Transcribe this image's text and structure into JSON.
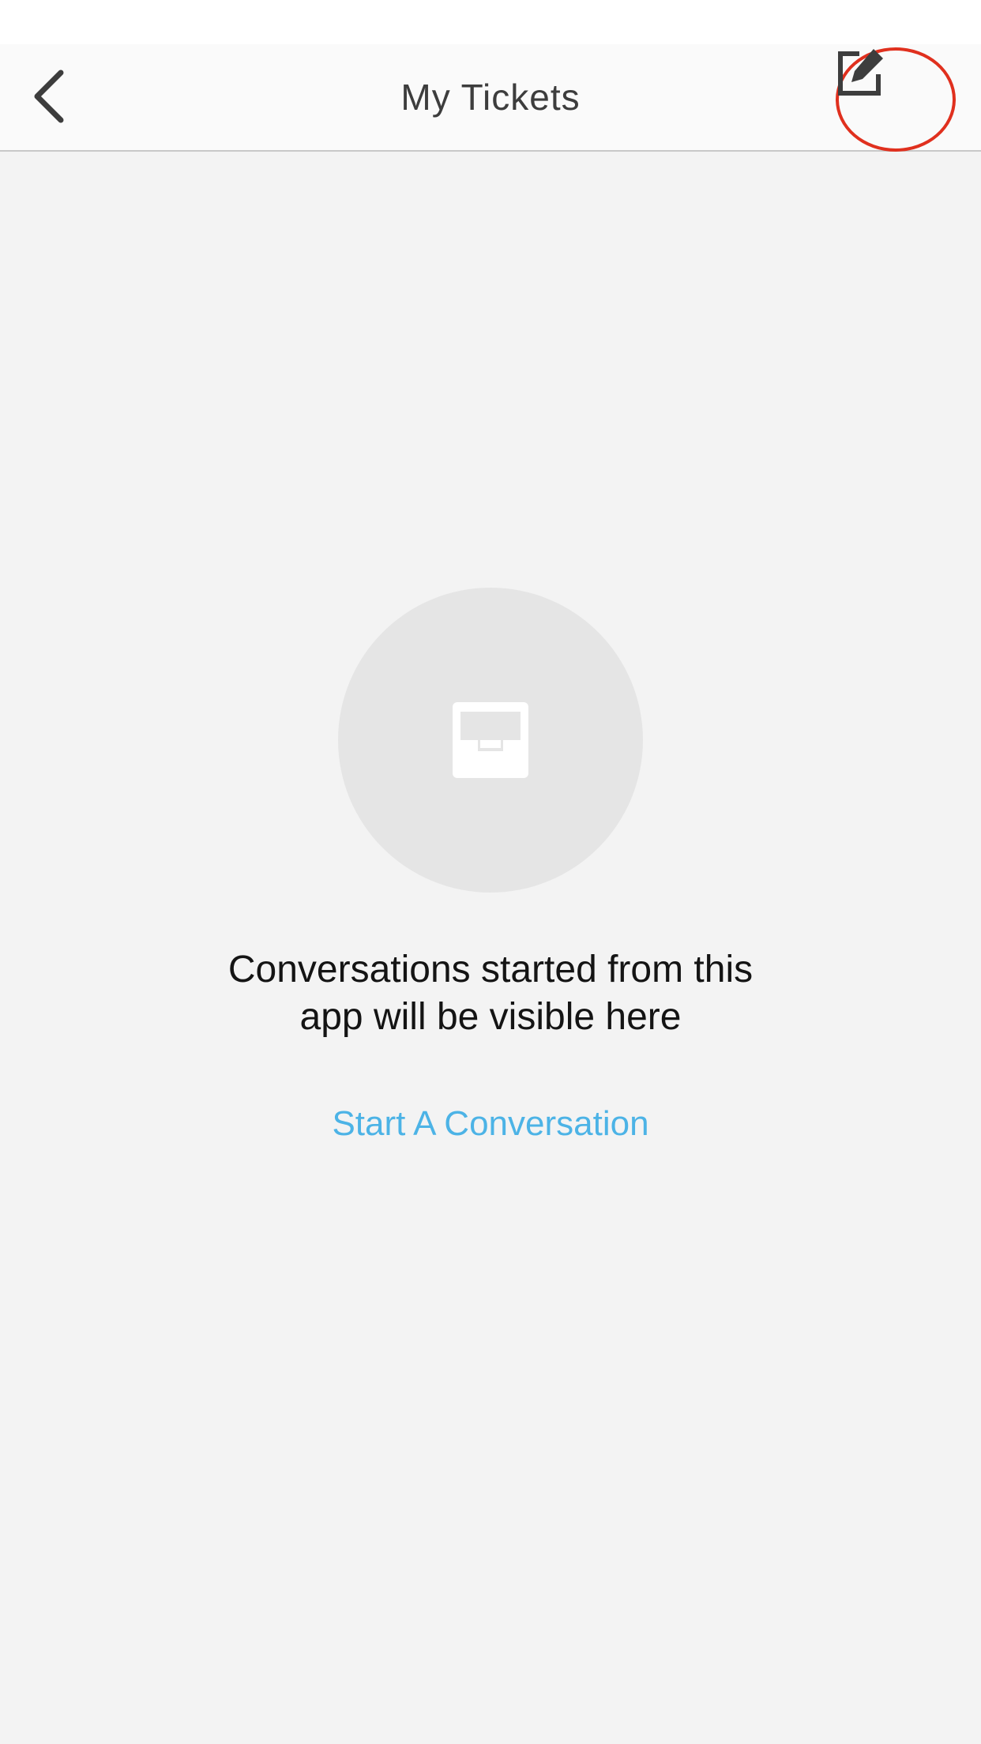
{
  "nav": {
    "title": "My Tickets",
    "back_icon": "chevron-left-icon",
    "compose_icon": "compose-icon"
  },
  "empty_state": {
    "icon": "inbox-tray-icon",
    "message_line1": "Conversations started from this",
    "message_line2": "app will be visible here",
    "link_label": "Start A Conversation"
  },
  "colors": {
    "background": "#f3f3f3",
    "nav_background": "#fafafa",
    "title_text": "#3d3d3d",
    "link": "#4cb3e6",
    "highlight_ring": "#e0301e",
    "empty_circle": "#e5e5e5"
  }
}
